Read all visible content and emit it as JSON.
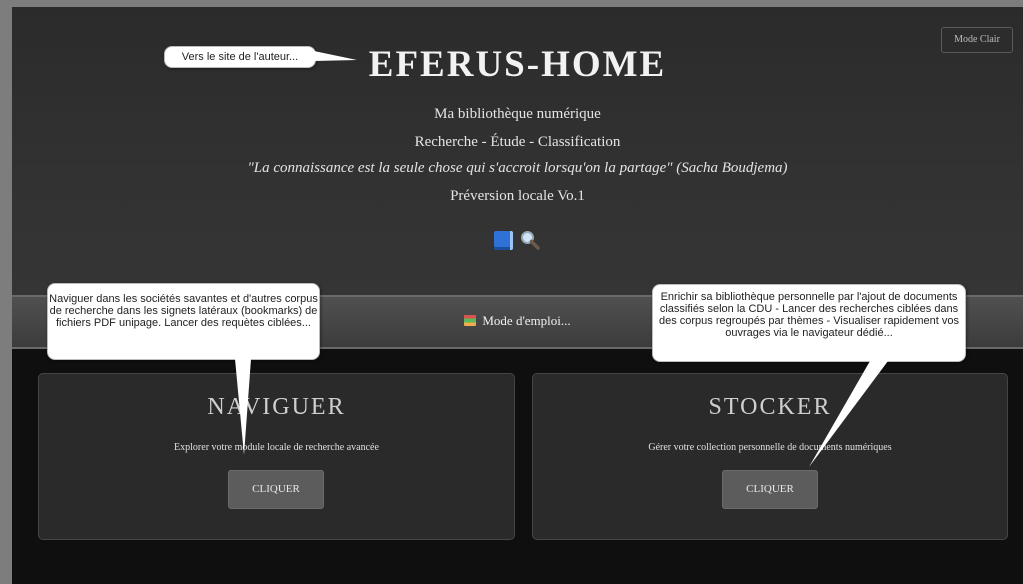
{
  "header": {
    "mode_button": "Mode Clair",
    "title": "EFERUS-HOME",
    "line1": "Ma bibliothèque numérique",
    "line2": "Recherche - Étude - Classification",
    "quote": "\"La connaissance est la seule chose qui s'accroit lorsqu'on la partage\" (Sacha Boudjema)",
    "version": "Préversion locale Vo.1",
    "icons": [
      "book-icon",
      "magnifier-icon"
    ]
  },
  "nav": {
    "manual_label": "Mode d'emploi...",
    "manual_icon": "books-icon"
  },
  "cards": [
    {
      "title": "NAVIGUER",
      "description": "Explorer votre module locale de recherche avancée",
      "button": "CLIQUER"
    },
    {
      "title": "STOCKER",
      "description": "Gérer votre collection personnelle de documents numériques",
      "button": "CLIQUER"
    }
  ],
  "tooltips": {
    "author": "Vers le site de l'auteur...",
    "naviguer": "Naviguer dans les sociétés savantes et d'autres corpus de recherche dans les signets latéraux (bookmarks) de fichiers PDF unipage. Lancer des requètes ciblées...",
    "stocker": "Enrichir sa bibliothèque personnelle par l'ajout de documents classifiés selon la CDU - Lancer des recherches ciblées dans des corpus regroupés par thèmes - Visualiser rapidement vos ouvrages via le navigateur dédié..."
  },
  "colors": {
    "hero_bg": "#323232",
    "page_bg": "#0f0f0f",
    "card_bg": "#2a2a2a",
    "button_bg": "#5c5c5c",
    "outer_bg": "#7d7d7d"
  }
}
